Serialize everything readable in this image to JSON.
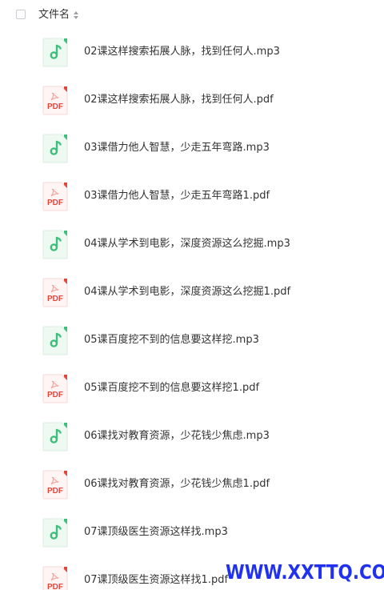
{
  "header": {
    "column_label": "文件名"
  },
  "files": [
    {
      "name": "02课这样搜索拓展人脉，找到任何人.mp3",
      "type": "audio"
    },
    {
      "name": "02课这样搜索拓展人脉，找到任何人.pdf",
      "type": "pdf"
    },
    {
      "name": "03课借力他人智慧，少走五年弯路.mp3",
      "type": "audio"
    },
    {
      "name": "03课借力他人智慧，少走五年弯路1.pdf",
      "type": "pdf"
    },
    {
      "name": "04课从学术到电影，深度资源这么挖掘.mp3",
      "type": "audio"
    },
    {
      "name": "04课从学术到电影，深度资源这么挖掘1.pdf",
      "type": "pdf"
    },
    {
      "name": "05课百度挖不到的信息要这样挖.mp3",
      "type": "audio"
    },
    {
      "name": "05课百度挖不到的信息要这样挖1.pdf",
      "type": "pdf"
    },
    {
      "name": "06课找对教育资源，少花钱少焦虑.mp3",
      "type": "audio"
    },
    {
      "name": "06课找对教育资源，少花钱少焦虑1.pdf",
      "type": "pdf"
    },
    {
      "name": "07课顶级医生资源这样找.mp3",
      "type": "audio"
    },
    {
      "name": "07课顶级医生资源这样找1.pdf",
      "type": "pdf"
    }
  ],
  "icons": {
    "audio": "music-file-icon",
    "pdf": "pdf-file-icon",
    "pdf_label": "PDF"
  },
  "watermark": "WWW.XXTTQ.COM",
  "colors": {
    "audio_accent": "#3cc07a",
    "pdf_accent": "#e0483e",
    "watermark": "#2032f0"
  }
}
